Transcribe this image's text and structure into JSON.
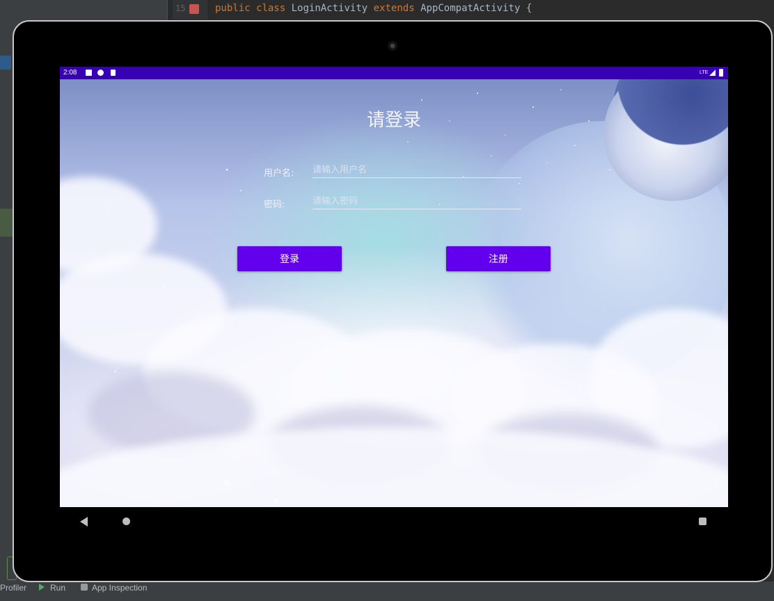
{
  "ide": {
    "line_number": "15",
    "code": {
      "kw1": "public",
      "kw2": "class",
      "name": "LoginActivity",
      "kw3": "extends",
      "parent": "AppCompatActivity",
      "brace": "{"
    },
    "bottom_tabs": [
      "Profiler",
      "Run",
      "App Inspection"
    ]
  },
  "device": {
    "status_bar": {
      "time": "2:08",
      "network": "LTE",
      "icons": [
        "a-icon",
        "globe-icon",
        "sd-card-icon",
        "signal-icon",
        "battery-icon"
      ]
    },
    "nav_icons": [
      "back-icon",
      "home-icon",
      "recents-icon"
    ]
  },
  "login": {
    "title": "请登录",
    "username_label": "用户名:",
    "username_placeholder": "请输入用户名",
    "username_value": "",
    "password_label": "密码:",
    "password_placeholder": "请输入密码",
    "password_value": "",
    "login_button": "登录",
    "register_button": "注册"
  },
  "colors": {
    "status_bar": "#3700b3",
    "button": "#6200ee",
    "ide_keyword": "#cc7832",
    "ide_text": "#a9b7c6"
  }
}
